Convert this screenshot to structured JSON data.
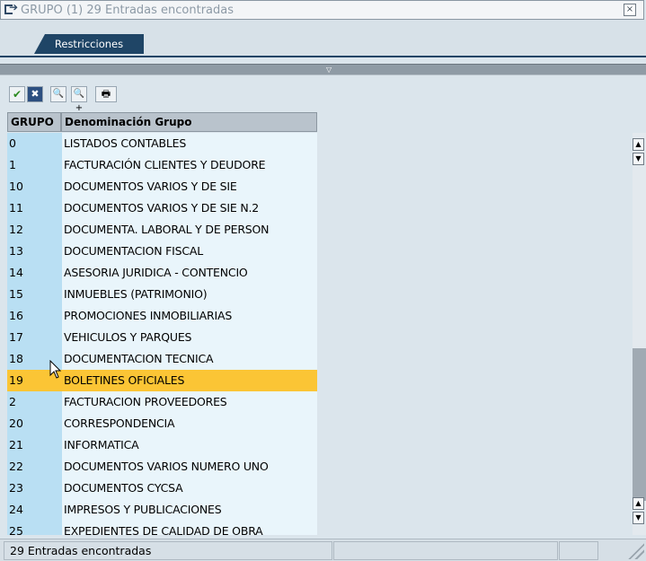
{
  "window": {
    "title": "GRUPO (1)   29 Entradas encontradas"
  },
  "tabs": [
    {
      "label": "Restricciones"
    }
  ],
  "toolbar": {
    "buttons": [
      {
        "icon": "check-icon",
        "label": "✔"
      },
      {
        "icon": "cancel-icon",
        "label": "✖"
      },
      {
        "icon": "find-icon",
        "label": "🔍"
      },
      {
        "icon": "find-next-icon",
        "label": "🔍+"
      },
      {
        "icon": "print-icon",
        "label": "🖶"
      }
    ]
  },
  "table": {
    "columns": [
      "GRUPO",
      "Denominación Grupo"
    ],
    "selected_index": 11,
    "rows": [
      [
        "0",
        "LISTADOS CONTABLES"
      ],
      [
        "1",
        "FACTURACIÓN CLIENTES Y DEUDORE"
      ],
      [
        "10",
        "DOCUMENTOS VARIOS Y DE SIE"
      ],
      [
        "11",
        "DOCUMENTOS VARIOS Y DE SIE N.2"
      ],
      [
        "12",
        "DOCUMENTA. LABORAL Y DE PERSON"
      ],
      [
        "13",
        "DOCUMENTACION FISCAL"
      ],
      [
        "14",
        "ASESORIA  JURIDICA - CONTENCIO"
      ],
      [
        "15",
        "INMUEBLES (PATRIMONIO)"
      ],
      [
        "16",
        "PROMOCIONES INMOBILIARIAS"
      ],
      [
        "17",
        "VEHICULOS Y PARQUES"
      ],
      [
        "18",
        "DOCUMENTACION TECNICA"
      ],
      [
        "19",
        "BOLETINES OFICIALES"
      ],
      [
        "2",
        "FACTURACION PROVEEDORES"
      ],
      [
        "20",
        "CORRESPONDENCIA"
      ],
      [
        "21",
        "INFORMATICA"
      ],
      [
        "22",
        "DOCUMENTOS VARIOS NUMERO UNO"
      ],
      [
        "23",
        "DOCUMENTOS CYCSA"
      ],
      [
        "24",
        "IMPRESOS Y PUBLICACIONES"
      ],
      [
        "25",
        "EXPEDIENTES DE CALIDAD DE OBRA"
      ]
    ]
  },
  "status": {
    "message": "29 Entradas encontradas"
  }
}
